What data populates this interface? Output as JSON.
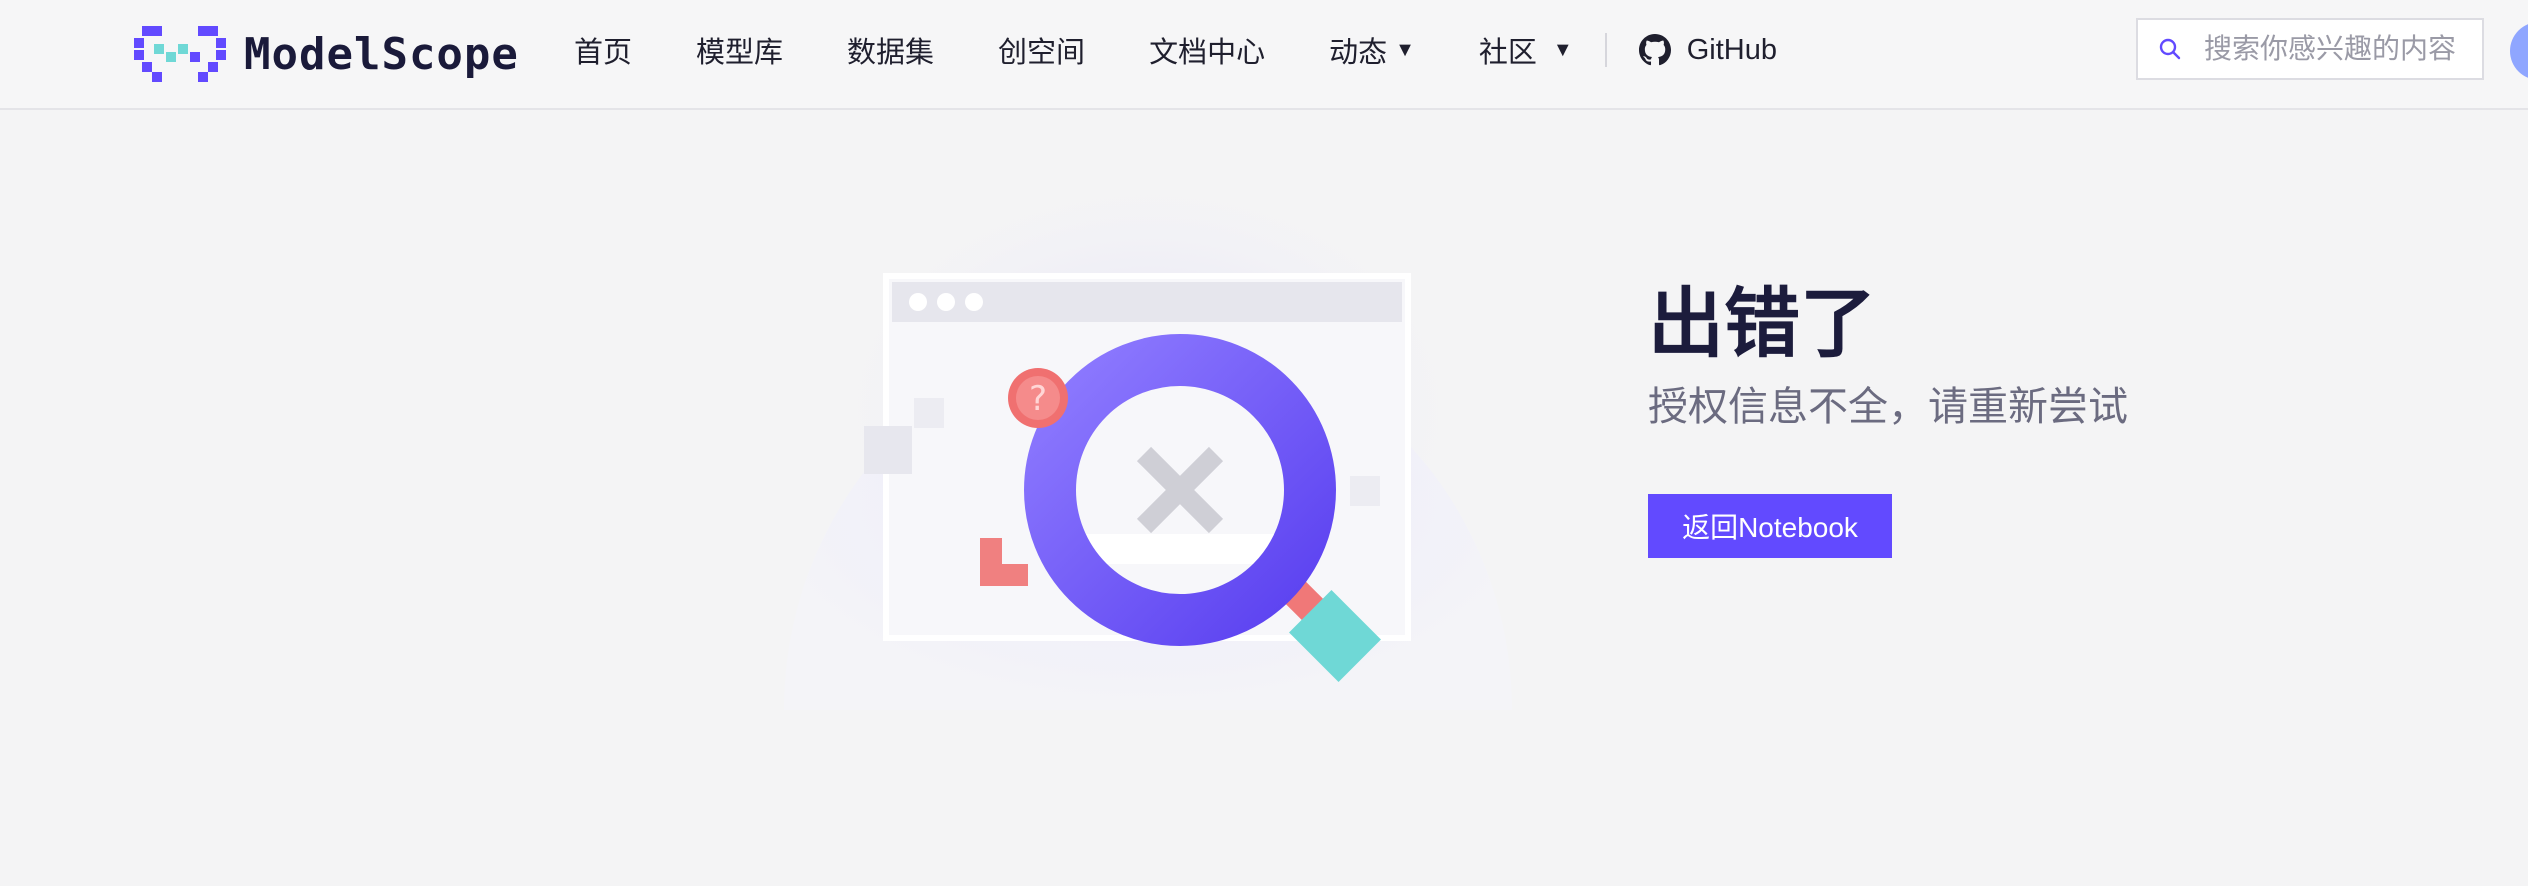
{
  "header": {
    "logo_text": "ModelScope",
    "nav": [
      {
        "label": "首页"
      },
      {
        "label": "模型库"
      },
      {
        "label": "数据集"
      },
      {
        "label": "创空间"
      },
      {
        "label": "文档中心"
      },
      {
        "label": "动态",
        "dropdown": true
      },
      {
        "label": "社区",
        "dropdown": true
      }
    ],
    "github_label": "GitHub",
    "search_placeholder": "搜索你感兴趣的内容"
  },
  "error": {
    "title": "出错了",
    "message": "授权信息不全，请重新尝试",
    "button_label": "返回Notebook"
  },
  "colors": {
    "brand": "#624aff",
    "accent_teal": "#6fd8d6",
    "accent_red": "#f07070",
    "title": "#1c1c3c"
  },
  "icons": {
    "caret": "▼"
  }
}
